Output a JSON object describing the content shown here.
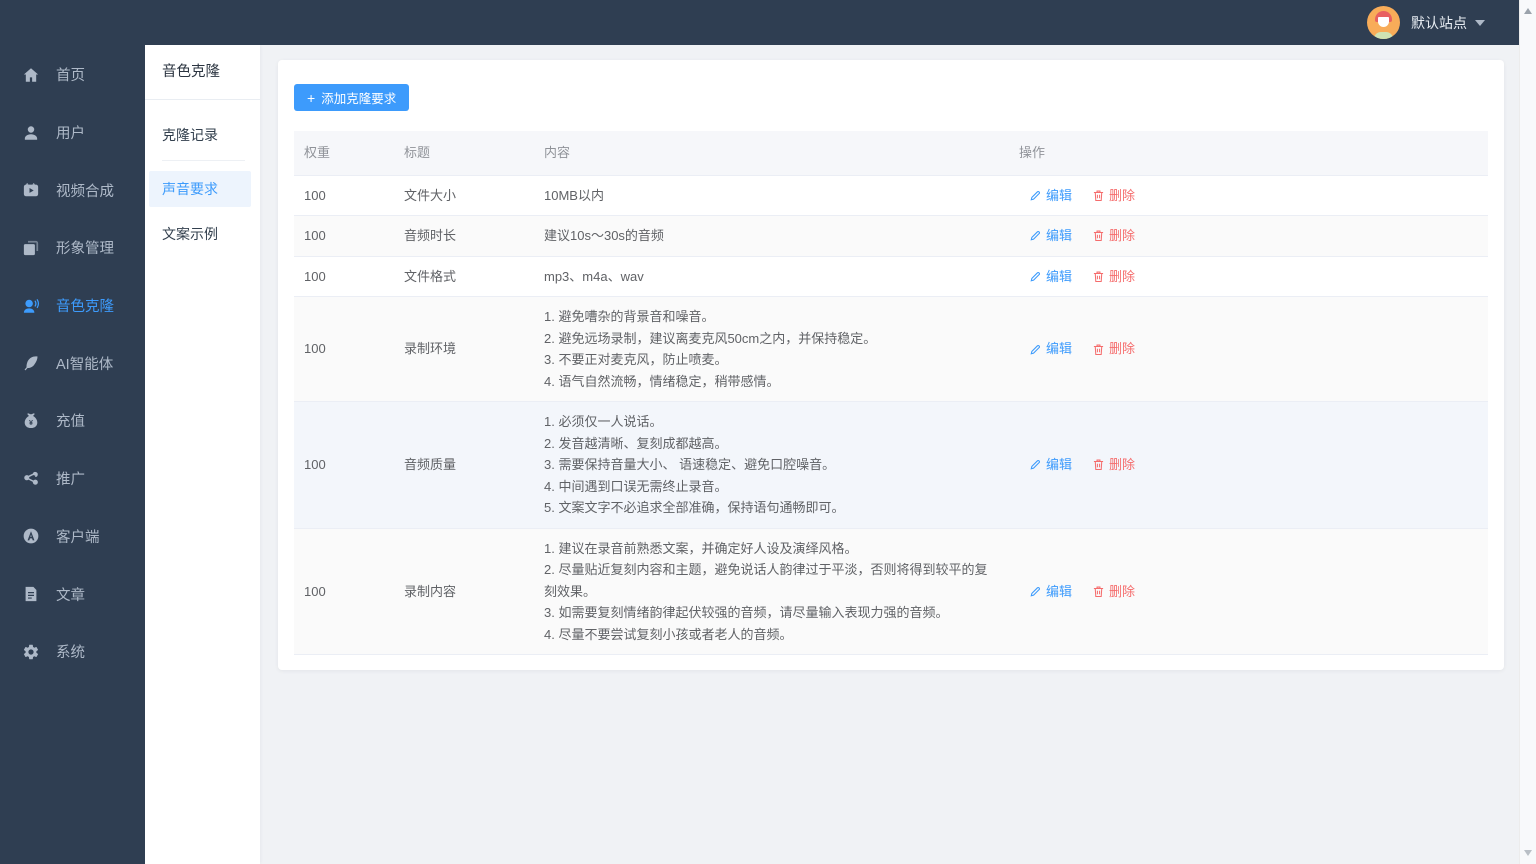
{
  "colors": {
    "sidebar_bg": "#2f3e52",
    "accent": "#3d9bfc",
    "danger": "#f56c6c",
    "page_bg": "#f0f2f5",
    "stripe": "#fafafa",
    "hover_row": "#f3f6fb"
  },
  "topbar": {
    "site_label": "默认站点"
  },
  "sidebar": {
    "items": [
      {
        "label": "首页",
        "icon": "home",
        "active": false
      },
      {
        "label": "用户",
        "icon": "user",
        "active": false
      },
      {
        "label": "视频合成",
        "icon": "video",
        "active": false
      },
      {
        "label": "形象管理",
        "icon": "copy",
        "active": false
      },
      {
        "label": "音色克隆",
        "icon": "voice",
        "active": true
      },
      {
        "label": "AI智能体",
        "icon": "feather",
        "active": false
      },
      {
        "label": "充值",
        "icon": "money",
        "active": false
      },
      {
        "label": "推广",
        "icon": "share",
        "active": false
      },
      {
        "label": "客户端",
        "icon": "app",
        "active": false
      },
      {
        "label": "文章",
        "icon": "article",
        "active": false
      },
      {
        "label": "系统",
        "icon": "gear",
        "active": false
      }
    ]
  },
  "submenu": {
    "title": "音色克隆",
    "items": [
      {
        "label": "克隆记录",
        "active": false
      },
      {
        "label": "声音要求",
        "active": true
      },
      {
        "label": "文案示例",
        "active": false
      }
    ]
  },
  "main": {
    "add_button": {
      "icon": "plus",
      "plus_glyph": "+",
      "label": "添加克隆要求"
    },
    "table": {
      "headers": [
        "权重",
        "标题",
        "内容",
        "操作"
      ],
      "edit_label": "编辑",
      "delete_label": "删除",
      "rows": [
        {
          "weight": "100",
          "title": "文件大小",
          "content": [
            "10MB以内"
          ]
        },
        {
          "weight": "100",
          "title": "音频时长",
          "content": [
            "建议10s～30s的音频"
          ]
        },
        {
          "weight": "100",
          "title": "文件格式",
          "content": [
            "mp3、m4a、wav"
          ]
        },
        {
          "weight": "100",
          "title": "录制环境",
          "content": [
            "1. 避免嘈杂的背景音和噪音。",
            "2. 避免远场录制，建议离麦克风50cm之内，并保持稳定。",
            "3. 不要正对麦克风，防止喷麦。",
            "4. 语气自然流畅，情绪稳定，稍带感情。"
          ]
        },
        {
          "weight": "100",
          "title": "音频质量",
          "hover": true,
          "content": [
            "1. 必须仅一人说话。",
            "2. 发音越清晰、复刻成都越高。",
            "3. 需要保持音量大小、 语速稳定、避免口腔噪音。",
            "4. 中间遇到口误无需终止录音。",
            "5. 文案文字不必追求全部准确，保持语句通畅即可。"
          ]
        },
        {
          "weight": "100",
          "title": "录制内容",
          "content": [
            "1. 建议在录音前熟悉文案，并确定好人设及演绎风格。",
            "2. 尽量贴近复刻内容和主题，避免说话人韵律过于平淡，否则将得到较平的复刻效果。",
            "3. 如需要复刻情绪韵律起伏较强的音频，请尽量输入表现力强的音频。",
            "4. 尽量不要尝试复刻小孩或者老人的音频。"
          ]
        }
      ]
    }
  }
}
